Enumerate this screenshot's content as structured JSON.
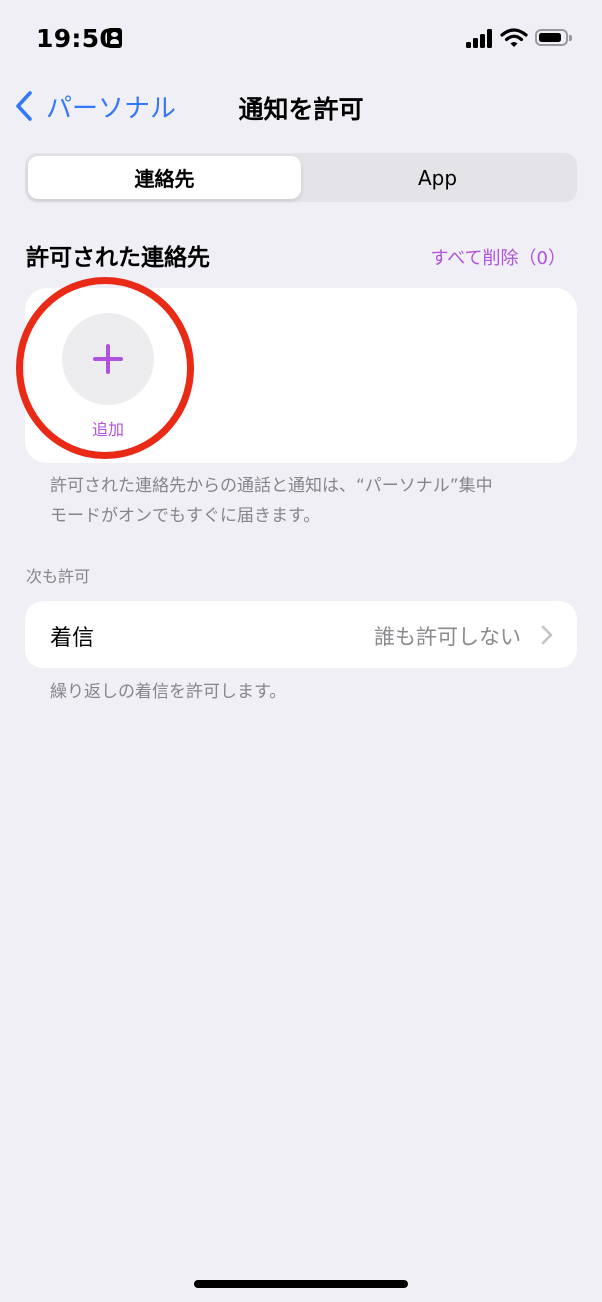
{
  "status_bar": {
    "time": "19:50"
  },
  "nav": {
    "back_label": "パーソナル",
    "title": "通知を許可"
  },
  "segments": [
    {
      "label": "連絡先",
      "selected": true
    },
    {
      "label": "App",
      "selected": false
    }
  ],
  "allowed_contacts": {
    "title": "許可された連絡先",
    "remove_all": "すべて削除（0）",
    "add_label": "追加",
    "footnote_line1": "許可された連絡先からの通話と通知は、“パーソナル”集中",
    "footnote_line2": "モードがオンでもすぐに届きます。"
  },
  "also_allow": {
    "header": "次も許可",
    "calls_label": "着信",
    "calls_value": "誰も許可しない",
    "footnote": "繰り返しの着信を許可します。"
  },
  "colors": {
    "accent_purple": "#AF52DE",
    "link_blue": "#3478F6",
    "annotation_red": "#E82A17",
    "background": "#F0EFF5"
  }
}
